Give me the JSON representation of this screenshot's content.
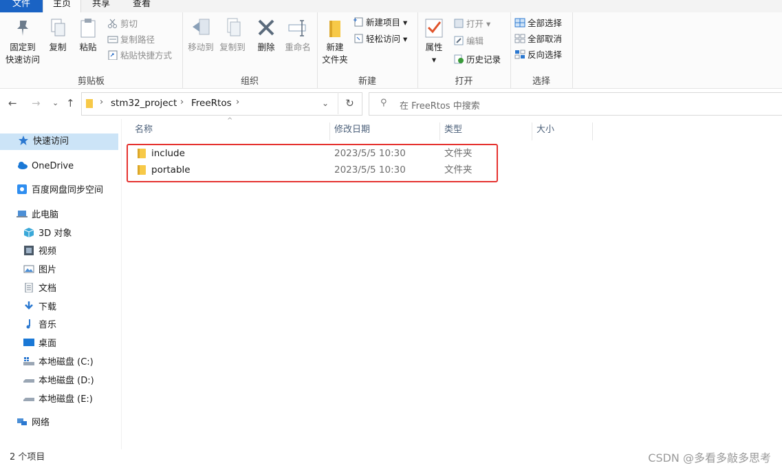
{
  "menu_tabs": {
    "file": "文件",
    "home": "主页",
    "share": "共享",
    "view": "查看"
  },
  "ribbon": {
    "clipboard": {
      "pin": "固定到",
      "pin2": "快速访问",
      "copy": "复制",
      "paste": "粘贴",
      "cut": "剪切",
      "copy_path": "复制路径",
      "paste_shortcut": "粘贴快捷方式",
      "group": "剪贴板"
    },
    "organize": {
      "move_to": "移动到",
      "copy_to": "复制到",
      "delete": "删除",
      "rename": "重命名",
      "group": "组织"
    },
    "new": {
      "new_folder_1": "新建",
      "new_folder_2": "文件夹",
      "new_item": "新建项目",
      "easy_access": "轻松访问",
      "group": "新建"
    },
    "open": {
      "properties": "属性",
      "open": "打开",
      "edit": "编辑",
      "history": "历史记录",
      "group": "打开"
    },
    "select": {
      "select_all": "全部选择",
      "select_none": "全部取消",
      "invert": "反向选择",
      "group": "选择"
    }
  },
  "address": {
    "crumbs": [
      "stm32_project",
      "FreeRtos"
    ],
    "search_placeholder": "在 FreeRtos 中搜索"
  },
  "nav": {
    "quick_access": "快速访问",
    "onedrive": "OneDrive",
    "baidu": "百度网盘同步空间",
    "this_pc": "此电脑",
    "objects3d": "3D 对象",
    "videos": "视频",
    "pictures": "图片",
    "documents": "文档",
    "downloads": "下载",
    "music": "音乐",
    "desktop": "桌面",
    "drive_c": "本地磁盘 (C:)",
    "drive_d": "本地磁盘 (D:)",
    "drive_e": "本地磁盘 (E:)",
    "network": "网络"
  },
  "columns": {
    "name": "名称",
    "date": "修改日期",
    "type": "类型",
    "size": "大小"
  },
  "files": [
    {
      "name": "include",
      "date": "2023/5/5 10:30",
      "type": "文件夹"
    },
    {
      "name": "portable",
      "date": "2023/5/5 10:30",
      "type": "文件夹"
    }
  ],
  "status": "2 个项目",
  "watermark": "CSDN @多看多敲多思考",
  "colors": {
    "accent": "#1a63c4",
    "highlight": "#e5312e",
    "folder": "#f7c948",
    "selection": "#cce4f7"
  }
}
